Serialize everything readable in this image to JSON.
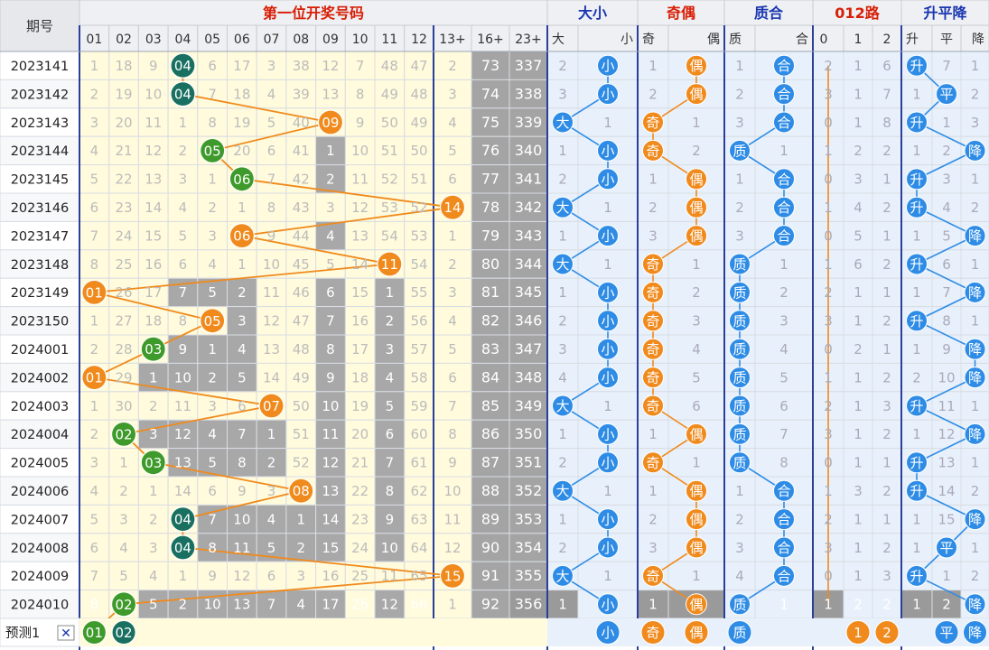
{
  "header": {
    "period_label": "期号",
    "groups": [
      "第一位开奖号码",
      "大小",
      "奇偶",
      "质合",
      "012路",
      "升平降"
    ],
    "columns": [
      "01",
      "02",
      "03",
      "04",
      "05",
      "06",
      "07",
      "08",
      "09",
      "10",
      "11",
      "12",
      "13+",
      "16+",
      "23+",
      "大",
      "小",
      "奇",
      "偶",
      "质",
      "合",
      "0",
      "1",
      "2",
      "升",
      "平",
      "降"
    ]
  },
  "colors": {
    "header_red": "#d81e06",
    "header_blue": "#1a35b0",
    "orange_ball": "#f08a1c",
    "green_ball": "#3e9a2a",
    "teal_ball": "#1a7060",
    "blue_ball": "#2e8ce6",
    "gray_cell": "#a8a8a8",
    "dark_gray_cell": "#8c8c8c"
  },
  "chart_data": {
    "type": "table",
    "title": "第一位开奖号码",
    "periods": [
      "2023141",
      "2023142",
      "2023143",
      "2023144",
      "2023145",
      "2023146",
      "2023147",
      "2023148",
      "2023149",
      "2023150",
      "2024001",
      "2024002",
      "2024003",
      "2024004",
      "2024005",
      "2024006",
      "2024007",
      "2024008",
      "2024009",
      "2024010"
    ],
    "first_digit": [
      4,
      4,
      9,
      5,
      6,
      14,
      6,
      11,
      1,
      5,
      3,
      1,
      7,
      2,
      3,
      8,
      4,
      4,
      15,
      2
    ],
    "rows": [
      [
        "1",
        "18",
        "9",
        "04",
        "6",
        "17",
        "3",
        "38",
        "12",
        "7",
        "48",
        "47",
        "2",
        "73",
        "337",
        "2",
        "小",
        "1",
        "偶",
        "1",
        "合",
        "2",
        "1",
        "6",
        "升",
        "7",
        "1"
      ],
      [
        "2",
        "19",
        "10",
        "04",
        "7",
        "18",
        "4",
        "39",
        "13",
        "8",
        "49",
        "48",
        "3",
        "74",
        "338",
        "3",
        "小",
        "2",
        "偶",
        "2",
        "合",
        "3",
        "1",
        "7",
        "1",
        "平",
        "2"
      ],
      [
        "3",
        "20",
        "11",
        "1",
        "8",
        "19",
        "5",
        "40",
        "09",
        "9",
        "50",
        "49",
        "4",
        "75",
        "339",
        "大",
        "1",
        "奇",
        "1",
        "3",
        "合",
        "0",
        "1",
        "8",
        "升",
        "1",
        "3"
      ],
      [
        "4",
        "21",
        "12",
        "2",
        "05",
        "20",
        "6",
        "41",
        "1",
        "10",
        "51",
        "50",
        "5",
        "76",
        "340",
        "1",
        "小",
        "奇",
        "2",
        "质",
        "1",
        "1",
        "2",
        "2",
        "1",
        "2",
        "降"
      ],
      [
        "5",
        "22",
        "13",
        "3",
        "1",
        "06",
        "7",
        "42",
        "2",
        "11",
        "52",
        "51",
        "6",
        "77",
        "341",
        "2",
        "小",
        "1",
        "偶",
        "1",
        "合",
        "0",
        "3",
        "1",
        "升",
        "3",
        "1"
      ],
      [
        "6",
        "23",
        "14",
        "4",
        "2",
        "1",
        "8",
        "43",
        "3",
        "12",
        "53",
        "52",
        "14",
        "78",
        "342",
        "大",
        "1",
        "2",
        "偶",
        "2",
        "合",
        "1",
        "4",
        "2",
        "升",
        "4",
        "2"
      ],
      [
        "7",
        "24",
        "15",
        "5",
        "3",
        "06",
        "9",
        "44",
        "4",
        "13",
        "54",
        "53",
        "1",
        "79",
        "343",
        "1",
        "小",
        "3",
        "偶",
        "3",
        "合",
        "0",
        "5",
        "1",
        "1",
        "5",
        "降"
      ],
      [
        "8",
        "25",
        "16",
        "6",
        "4",
        "1",
        "10",
        "45",
        "5",
        "14",
        "11",
        "54",
        "2",
        "80",
        "344",
        "大",
        "1",
        "奇",
        "1",
        "质",
        "1",
        "1",
        "6",
        "2",
        "升",
        "6",
        "1"
      ],
      [
        "01",
        "26",
        "17",
        "7",
        "5",
        "2",
        "11",
        "46",
        "6",
        "15",
        "1",
        "55",
        "3",
        "81",
        "345",
        "1",
        "小",
        "奇",
        "2",
        "质",
        "2",
        "2",
        "1",
        "1",
        "1",
        "7",
        "降"
      ],
      [
        "1",
        "27",
        "18",
        "8",
        "05",
        "3",
        "12",
        "47",
        "7",
        "16",
        "2",
        "56",
        "4",
        "82",
        "346",
        "2",
        "小",
        "奇",
        "3",
        "质",
        "3",
        "3",
        "1",
        "2",
        "升",
        "8",
        "1"
      ],
      [
        "2",
        "28",
        "03",
        "9",
        "1",
        "4",
        "13",
        "48",
        "8",
        "17",
        "3",
        "57",
        "5",
        "83",
        "347",
        "3",
        "小",
        "奇",
        "4",
        "质",
        "4",
        "0",
        "2",
        "1",
        "1",
        "9",
        "降"
      ],
      [
        "01",
        "29",
        "1",
        "10",
        "2",
        "5",
        "14",
        "49",
        "9",
        "18",
        "4",
        "58",
        "6",
        "84",
        "348",
        "4",
        "小",
        "奇",
        "5",
        "质",
        "5",
        "1",
        "1",
        "2",
        "2",
        "10",
        "降"
      ],
      [
        "1",
        "30",
        "2",
        "11",
        "3",
        "6",
        "07",
        "50",
        "10",
        "19",
        "5",
        "59",
        "7",
        "85",
        "349",
        "大",
        "1",
        "奇",
        "6",
        "质",
        "6",
        "2",
        "1",
        "3",
        "升",
        "11",
        "1"
      ],
      [
        "2",
        "02",
        "3",
        "12",
        "4",
        "7",
        "1",
        "51",
        "11",
        "20",
        "6",
        "60",
        "8",
        "86",
        "350",
        "1",
        "小",
        "1",
        "偶",
        "质",
        "7",
        "3",
        "1",
        "2",
        "1",
        "12",
        "降"
      ],
      [
        "3",
        "1",
        "03",
        "13",
        "5",
        "8",
        "2",
        "52",
        "12",
        "21",
        "7",
        "61",
        "9",
        "87",
        "351",
        "2",
        "小",
        "奇",
        "1",
        "质",
        "8",
        "0",
        "1",
        "1",
        "升",
        "13",
        "1"
      ],
      [
        "4",
        "2",
        "1",
        "14",
        "6",
        "9",
        "3",
        "08",
        "13",
        "22",
        "8",
        "62",
        "10",
        "88",
        "352",
        "大",
        "1",
        "1",
        "偶",
        "1",
        "合",
        "1",
        "3",
        "2",
        "升",
        "14",
        "2"
      ],
      [
        "5",
        "3",
        "2",
        "04",
        "7",
        "10",
        "4",
        "1",
        "14",
        "23",
        "9",
        "63",
        "11",
        "89",
        "353",
        "1",
        "小",
        "2",
        "偶",
        "2",
        "合",
        "2",
        "1",
        "1",
        "1",
        "15",
        "降"
      ],
      [
        "6",
        "4",
        "3",
        "04",
        "8",
        "11",
        "5",
        "2",
        "15",
        "24",
        "10",
        "64",
        "12",
        "90",
        "354",
        "2",
        "小",
        "3",
        "偶",
        "3",
        "合",
        "3",
        "1",
        "2",
        "1",
        "平",
        "1"
      ],
      [
        "7",
        "5",
        "4",
        "1",
        "9",
        "12",
        "6",
        "3",
        "16",
        "25",
        "11",
        "65",
        "15",
        "91",
        "355",
        "大",
        "1",
        "奇",
        "1",
        "4",
        "合",
        "0",
        "1",
        "3",
        "升",
        "1",
        "2"
      ],
      [
        "8",
        "02",
        "5",
        "2",
        "10",
        "13",
        "7",
        "4",
        "17",
        "26",
        "12",
        "66",
        "1",
        "92",
        "356",
        "1",
        "小",
        "1",
        "偶",
        "质",
        "1",
        "1",
        "2",
        "2",
        "1",
        "2",
        "降"
      ]
    ]
  },
  "footer": {
    "label": "预测1",
    "close_symbol": "✕",
    "pred_balls": [
      "01",
      "02"
    ],
    "pred_size": "小",
    "pred_parity": [
      "奇",
      "偶"
    ],
    "pred_prime": "质",
    "pred_012": [
      "1",
      "2"
    ],
    "pred_trend": [
      "平",
      "降"
    ]
  }
}
